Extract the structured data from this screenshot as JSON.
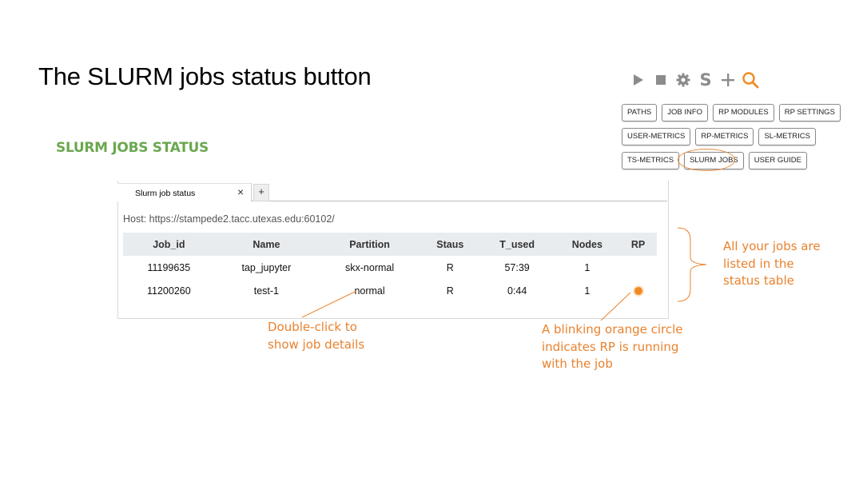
{
  "slide": {
    "title": "The SLURM jobs status button",
    "section_heading": "SLURM JOBS STATUS"
  },
  "toolbar": {
    "icons": [
      "play-icon",
      "stop-icon",
      "gear-icon",
      "s-icon",
      "plus-icon",
      "search-icon"
    ],
    "s_label": "S",
    "accent": "#f08a24",
    "icon_color": "#8c8c8c"
  },
  "menu_buttons": {
    "row1": [
      "PATHS",
      "JOB INFO",
      "RP MODULES",
      "RP SETTINGS"
    ],
    "row2": [
      "USER-METRICS",
      "RP-METRICS",
      "SL-METRICS"
    ],
    "row3": [
      "TS-METRICS",
      "SLURM JOBS",
      "USER GUIDE"
    ]
  },
  "panel": {
    "tab_label": "Slurm job status",
    "tab_close": "×",
    "tab_add": "+",
    "host": "Host: https://stampede2.tacc.utexas.edu:60102/"
  },
  "table": {
    "headers": [
      "Job_id",
      "Name",
      "Partition",
      "Staus",
      "T_used",
      "Nodes",
      "RP"
    ],
    "rows": [
      [
        "11199635",
        "tap_jupyter",
        "skx-normal",
        "R",
        "57:39",
        "1",
        ""
      ],
      [
        "11200260",
        "test-1",
        "normal",
        "R",
        "0:44",
        "1",
        ""
      ]
    ]
  },
  "annotations": {
    "double_click": [
      "Double-click to",
      "show job details"
    ],
    "blinking": [
      "A blinking orange circle",
      "indicates RP is running",
      "with the job"
    ],
    "all_jobs": [
      "All your jobs are",
      "listed in the",
      "status table"
    ]
  },
  "colors": {
    "heading_green": "#6aa84f",
    "annotation_orange": "#e9822e"
  }
}
